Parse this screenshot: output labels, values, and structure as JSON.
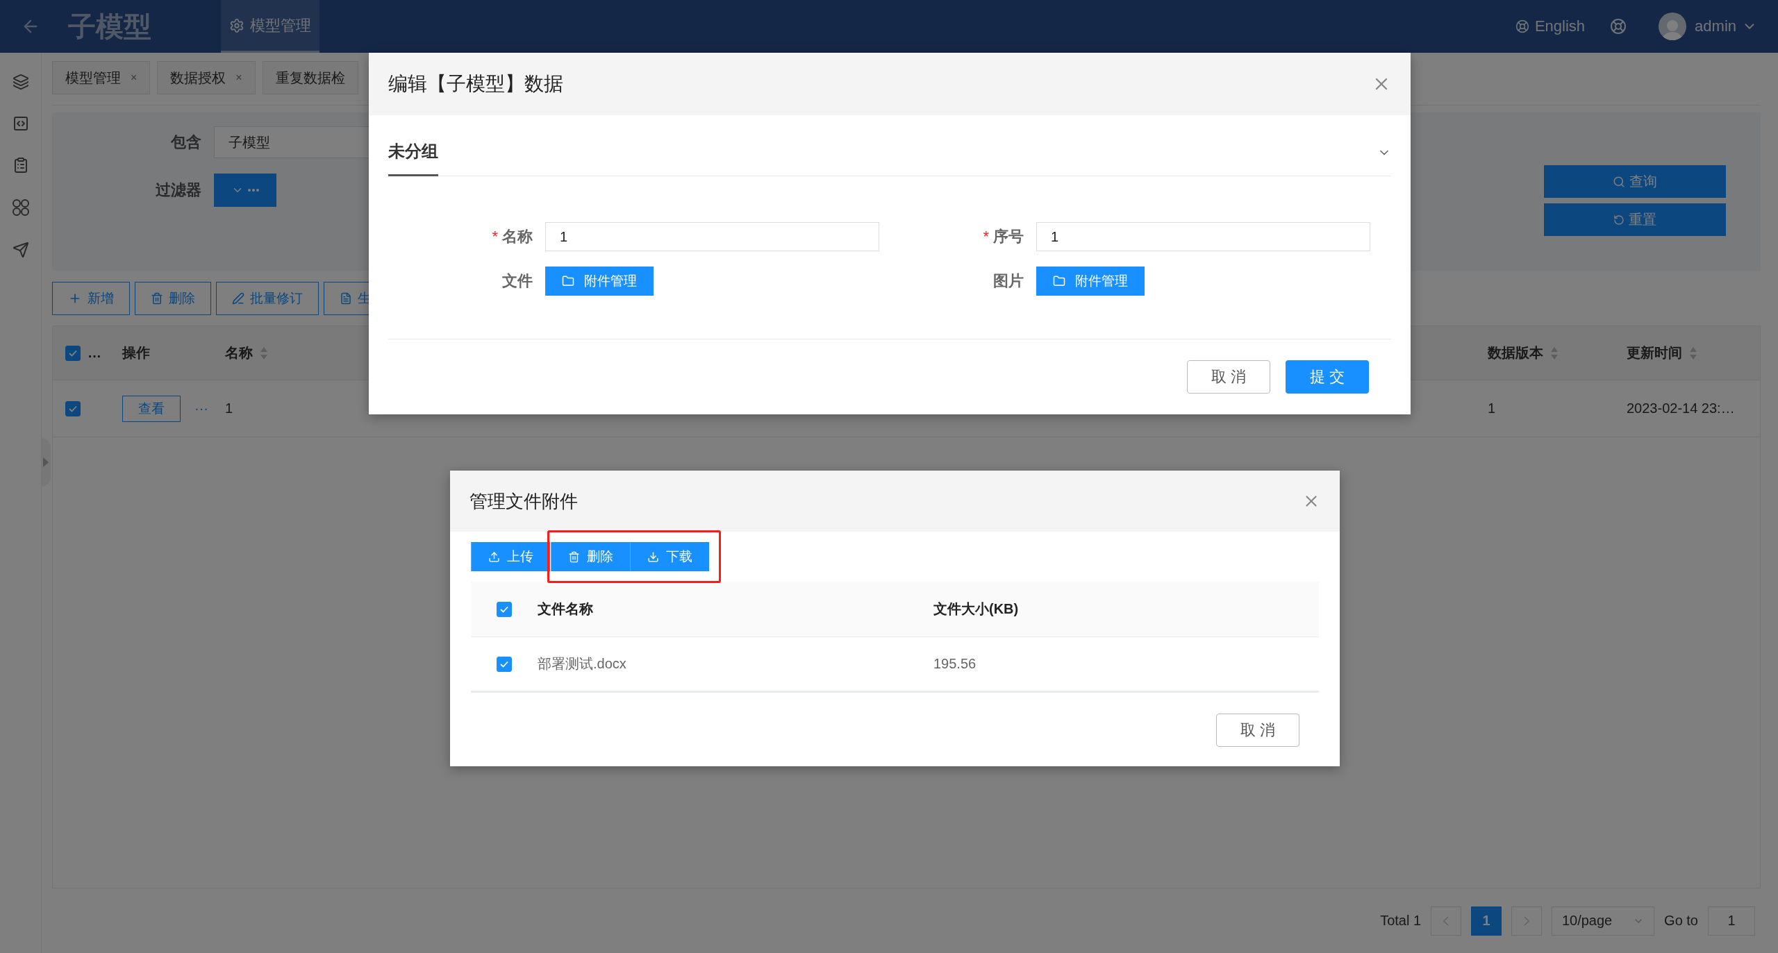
{
  "header": {
    "title": "子模型",
    "nav": [
      {
        "label": "模型管理",
        "selected": true
      }
    ],
    "language": "English",
    "user": "admin"
  },
  "tabs": [
    {
      "label": "模型管理",
      "close": "×"
    },
    {
      "label": "数据授权",
      "close": "×"
    },
    {
      "label": "重复数据检"
    }
  ],
  "filters": [
    {
      "label": "包含",
      "kind": "input",
      "value": "子模型"
    },
    {
      "label": "过滤器",
      "kind": "menu"
    }
  ],
  "search_buttons": [
    {
      "label": "查询",
      "kind": "search"
    },
    {
      "label": "重置",
      "kind": "reset"
    }
  ],
  "toolbar": [
    {
      "label": "新增",
      "kind": "add"
    },
    {
      "label": "删除",
      "kind": "delete"
    },
    {
      "label": "批量修订",
      "kind": "edit"
    },
    {
      "label": "生",
      "kind": "file"
    }
  ],
  "table": {
    "select_all": {
      "checked": true,
      "text": "…"
    },
    "columns": [
      {
        "label": "操作",
        "sortable": false
      },
      {
        "label": "名称",
        "sortable": true
      },
      {
        "label": "数据版本",
        "sortable": true
      },
      {
        "label": "更新时间",
        "sortable": true
      }
    ],
    "rows": [
      {
        "checked": true,
        "action": "查看",
        "more": "···",
        "name": "1",
        "version": "1",
        "updated": "2023-02-14 23:…"
      }
    ]
  },
  "pagination": {
    "total": "Total 1",
    "pages": [
      {
        "label": "1",
        "selected": true
      }
    ],
    "page_size": "10/page",
    "goto_label": "Go to",
    "goto_value": "1"
  },
  "edit_dialog": {
    "title": "编辑【子模型】数据",
    "group": {
      "title": "未分组",
      "expanded": true
    },
    "fields": [
      {
        "label": "名称",
        "required_mark": "*",
        "kind": "input",
        "value": "1"
      },
      {
        "label": "序号",
        "required_mark": "*",
        "kind": "input",
        "value": "1"
      },
      {
        "label": "文件",
        "kind": "attachment",
        "button": "附件管理"
      },
      {
        "label": "图片",
        "kind": "attachment",
        "button": "附件管理"
      }
    ],
    "cancel": "取 消",
    "submit": "提 交"
  },
  "file_dialog": {
    "title": "管理文件附件",
    "actions": [
      {
        "label": "上传",
        "kind": "upload"
      }
    ],
    "highlighted_actions": [
      {
        "label": "删除",
        "kind": "delete"
      },
      {
        "label": "下载",
        "kind": "download"
      }
    ],
    "columns": [
      {
        "label": "文件名称"
      },
      {
        "label": "文件大小(KB)"
      }
    ],
    "select_all": {
      "checked": true
    },
    "rows": [
      {
        "checked": true,
        "name": "部署测试.docx",
        "size": "195.56"
      }
    ],
    "cancel": "取 消"
  }
}
